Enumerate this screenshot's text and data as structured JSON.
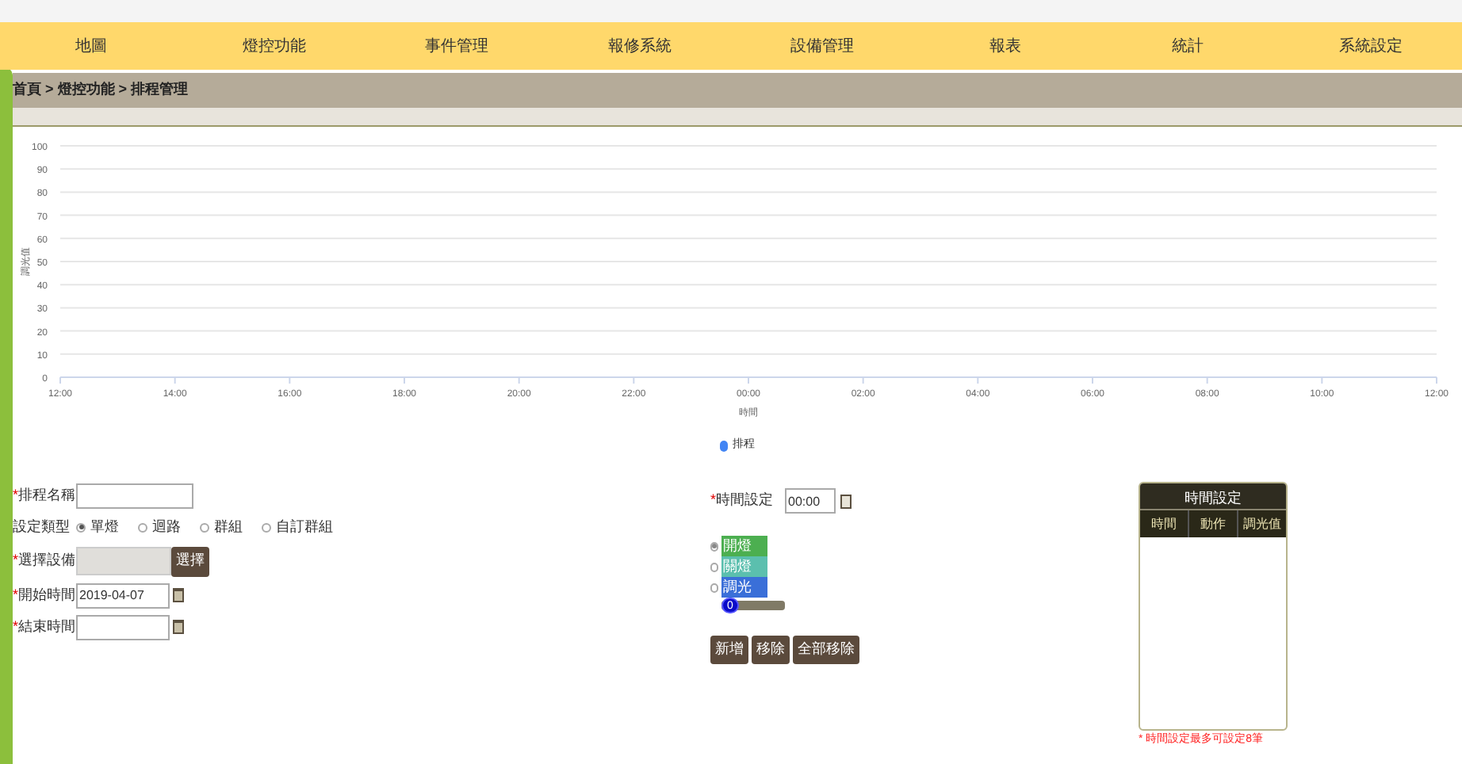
{
  "nav": {
    "items": [
      "地圖",
      "燈控功能",
      "事件管理",
      "報修系統",
      "設備管理",
      "報表",
      "統計",
      "系統設定"
    ]
  },
  "breadcrumb": "首頁 > 燈控功能 > 排程管理",
  "chart": {
    "chart_data": {
      "type": "line",
      "xlabel": "時間",
      "ylabel": "調光值",
      "categories": [
        "12:00",
        "14:00",
        "16:00",
        "18:00",
        "20:00",
        "22:00",
        "00:00",
        "02:00",
        "04:00",
        "06:00",
        "08:00",
        "10:00",
        "12:00"
      ],
      "series": [
        {
          "name": "排程",
          "color": "#4285f4",
          "values": [
            null,
            null,
            null,
            null,
            null,
            null,
            null,
            null,
            null,
            null,
            null,
            null,
            null
          ]
        }
      ],
      "grid": true,
      "ylim": [
        0,
        100
      ],
      "yticks": [
        0,
        10,
        20,
        30,
        40,
        50,
        60,
        70,
        80,
        90,
        100
      ]
    }
  },
  "form": {
    "name_label": {
      "mark": "*",
      "text": "排程名稱"
    },
    "type_label": {
      "text": "設定類型"
    },
    "types": [
      {
        "label": "單燈",
        "selected": true
      },
      {
        "label": "迴路",
        "selected": false
      },
      {
        "label": "群組",
        "selected": false
      },
      {
        "label": "自訂群組",
        "selected": false
      }
    ],
    "device_label": {
      "mark": "*",
      "text": "選擇設備"
    },
    "device_button": "選擇",
    "start_label": {
      "mark": "*",
      "text": "開始時間"
    },
    "start_value": "2019-04-07",
    "end_label": {
      "mark": "*",
      "text": "結束時間"
    }
  },
  "time": {
    "label": {
      "mark": "*",
      "text": "時間設定"
    },
    "value": "00:00",
    "actions": [
      {
        "label": "開燈",
        "selected": true,
        "color": "#4caf50"
      },
      {
        "label": "關燈",
        "selected": false,
        "color": "#5bbfae"
      },
      {
        "label": "調光",
        "selected": false,
        "color": "#3a6fd8"
      }
    ],
    "slider": {
      "reading": "0",
      "level": 0
    },
    "buttons": [
      "新增",
      "移除",
      "全部移除"
    ]
  },
  "table": {
    "title": "時間設定",
    "columns": [
      "時間",
      "動作",
      "調光值"
    ]
  },
  "note": "* 時間設定最多可設定8筆"
}
